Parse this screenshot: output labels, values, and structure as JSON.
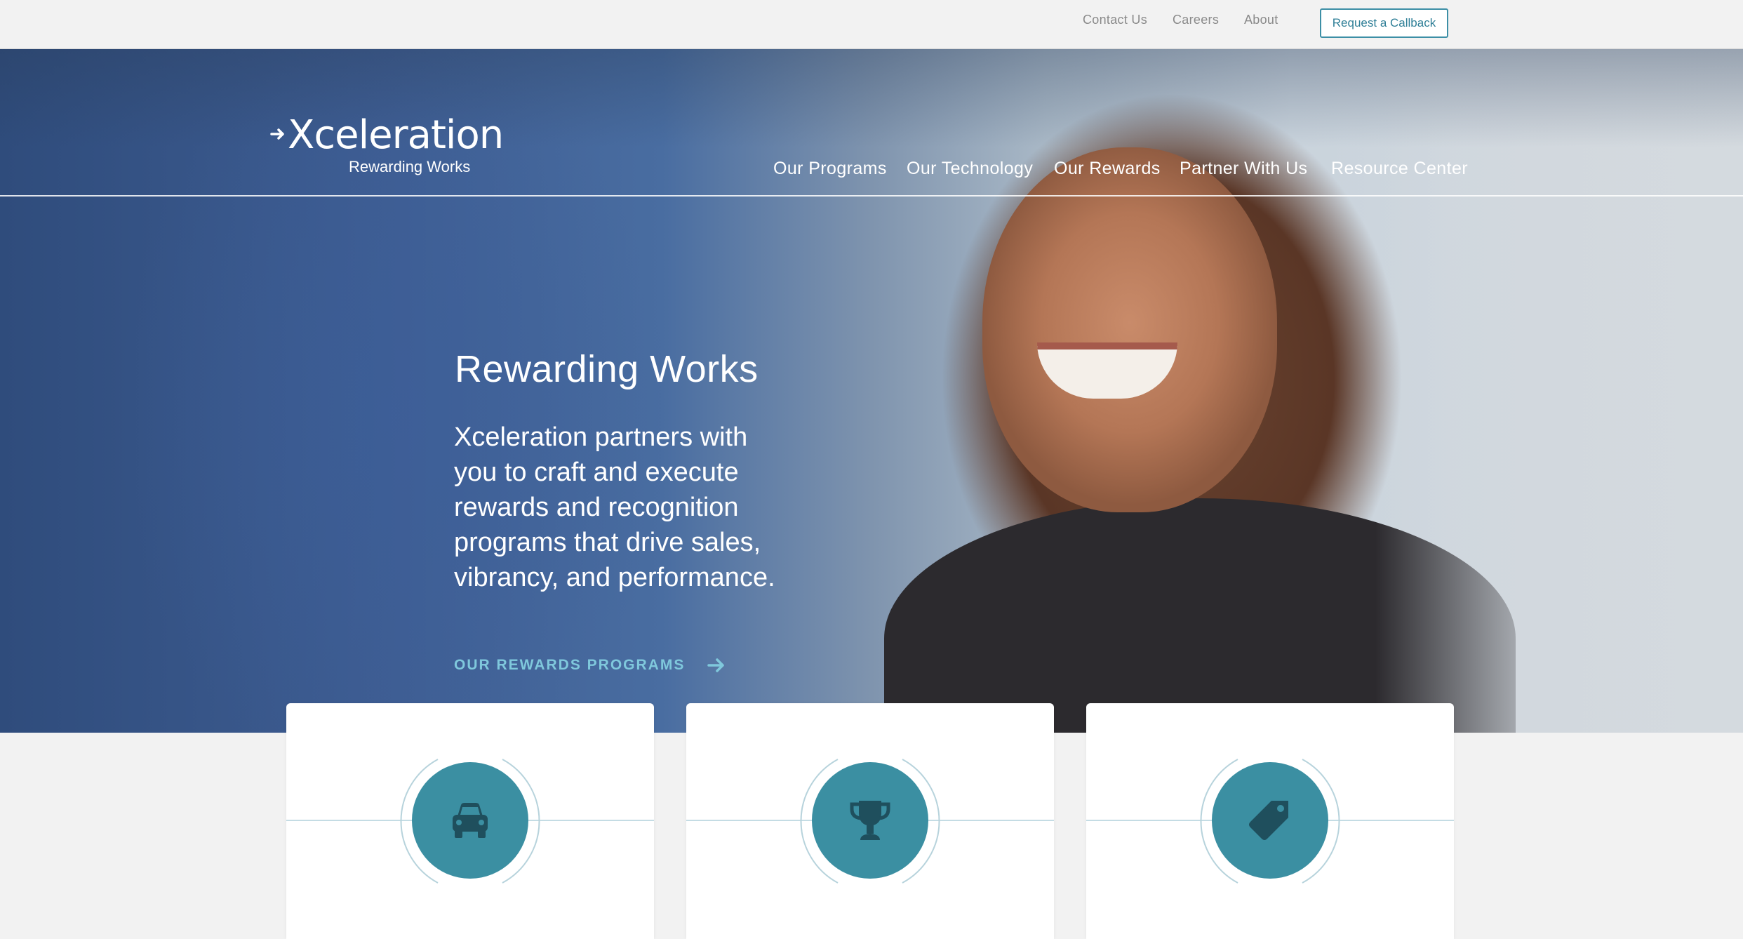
{
  "utility_nav": {
    "items": [
      {
        "label": "Contact Us"
      },
      {
        "label": "Careers"
      },
      {
        "label": "About"
      }
    ],
    "callback_label": "Request a Callback"
  },
  "brand": {
    "logo_word": "Xceleration",
    "tagline": "Rewarding Works"
  },
  "main_nav": {
    "items": [
      {
        "label": "Our Programs"
      },
      {
        "label": "Our Technology"
      },
      {
        "label": "Our Rewards"
      },
      {
        "label": "Partner With Us"
      },
      {
        "label": "Resource Center"
      }
    ]
  },
  "hero": {
    "title": "Rewarding Works",
    "body": "Xceleration partners with you to craft and execute rewards and recognition programs that drive sales, vibrancy, and performance.",
    "cta_label": "OUR REWARDS PROGRAMS"
  },
  "cards": [
    {
      "icon": "car-icon"
    },
    {
      "icon": "trophy-icon"
    },
    {
      "icon": "tag-icon"
    }
  ],
  "colors": {
    "accent": "#3b8fa2",
    "cta_text": "#7fc8dc",
    "callback_border": "#3d8fa6",
    "icon_dark": "#1f4f5d"
  }
}
